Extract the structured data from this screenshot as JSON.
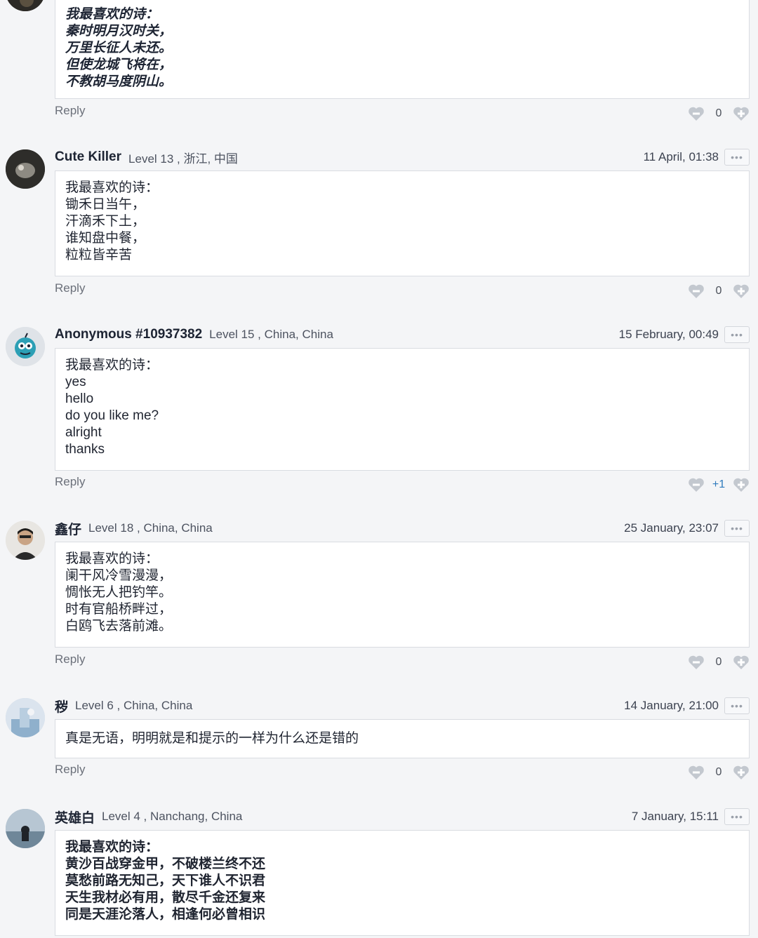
{
  "comments": [
    {
      "username": "",
      "meta": "",
      "date": "",
      "lines": [
        "我最喜欢的诗：",
        "秦时明月汉时关，",
        "万里长征人未还。",
        "但使龙城飞将在，",
        "不教胡马度阴山。"
      ],
      "reply": "Reply",
      "votes": "0",
      "style": "bold-italic"
    },
    {
      "username": "Cute Killer",
      "meta": "Level 13 , 浙江, 中国",
      "date": "11 April, 01:38",
      "lines": [
        "我最喜欢的诗：",
        "锄禾日当午，",
        "汗滴禾下土，",
        "谁知盘中餐，",
        "粒粒皆辛苦"
      ],
      "reply": "Reply",
      "votes": "0"
    },
    {
      "username": "Anonymous #10937382",
      "meta": "Level 15 , China, China",
      "date": "15 February, 00:49",
      "lines": [
        "我最喜欢的诗：",
        "yes",
        "hello",
        "do you like me?",
        "alright",
        "thanks"
      ],
      "reply": "Reply",
      "votes": "+1"
    },
    {
      "username": "鑫仔",
      "meta": "Level 18 , China, China",
      "date": "25 January, 23:07",
      "lines": [
        "我最喜欢的诗：",
        "阑干风冷雪漫漫，",
        "惆怅无人把钓竿。",
        "时有官船桥畔过，",
        "白鸥飞去落前滩。"
      ],
      "reply": "Reply",
      "votes": "0"
    },
    {
      "username": "秽",
      "meta": "Level 6 , China, China",
      "date": "14 January, 21:00",
      "lines": [
        "真是无语，明明就是和提示的一样为什么还是错的"
      ],
      "reply": "Reply",
      "votes": "0"
    },
    {
      "username": "英雄白",
      "meta": "Level 4 , Nanchang, China",
      "date": "7 January, 15:11",
      "lines": [
        "我最喜欢的诗：",
        "黄沙百战穿金甲，不破楼兰终不还",
        "莫愁前路无知己，天下谁人不识君",
        "天生我材必有用，散尽千金还复来",
        "同是天涯沦落人，相逢何必曾相识"
      ],
      "style": "bold"
    }
  ],
  "more_label": "•••",
  "colors": {
    "accent": "#2f7bbd",
    "vote_icon": "#c3c8cf"
  },
  "icons": {
    "downvote": "heart-minus-icon",
    "upvote": "heart-plus-icon",
    "more": "more-dots-icon"
  }
}
